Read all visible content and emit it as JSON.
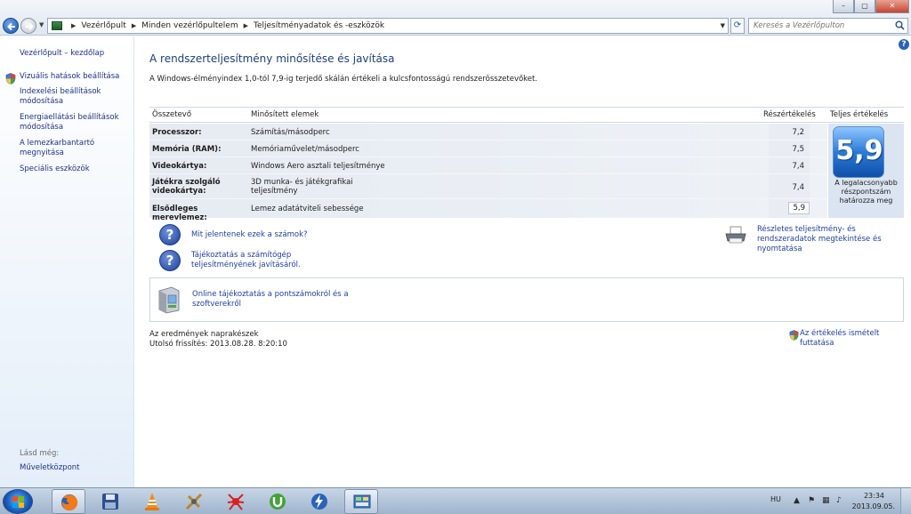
{
  "window": {
    "breadcrumb": [
      "Vezérlőpult",
      "Minden vezérlőpultelem",
      "Teljesítményadatok és -eszközök"
    ],
    "search_placeholder": "Keresés a Vezérlőpulton",
    "controls": {
      "minimize": "–",
      "maximize": "▢",
      "close": "✕"
    }
  },
  "sidebar": {
    "home": "Vezérlőpult – kezdőlap",
    "items": [
      "Vizuális hatások beállítása",
      "Indexelési beállítások módosítása",
      "Energiaellátási beállítások módosítása",
      "A lemezkarbantartó megnyitása",
      "Speciális eszközök"
    ],
    "see_also": "Lásd még:",
    "action_center": "Műveletközpont"
  },
  "main": {
    "title": "A rendszerteljesítmény minősítése és javítása",
    "subtitle": "A Windows-élményindex 1,0-tól 7,9-ig terjedő skálán értékeli a kulcsfontosságú rendszerösszetevőket.",
    "table": {
      "headers": [
        "Összetevő",
        "Minősített elemek",
        "Részértékelés",
        "Teljes értékelés"
      ],
      "rows": [
        {
          "component": "Processzor:",
          "rated": "Számítás/másodperc",
          "score": "7,2"
        },
        {
          "component": "Memória (RAM):",
          "rated": "Memóriaművelet/másodperc",
          "score": "7,5"
        },
        {
          "component": "Videokártya:",
          "rated": "Windows Aero asztali teljesítménye",
          "score": "7,4"
        },
        {
          "component": "Játékra szolgáló videokártya:",
          "rated": "3D munka- és játékgrafikai teljesítmény",
          "score": "7,4"
        },
        {
          "component": "Elsődleges merevlemez:",
          "rated": "Lemez adatátviteli sebessége",
          "score": "5,9"
        }
      ],
      "base_score": "5,9",
      "base_score_text": "A legalacsonyabb részpontszám határozza meg"
    },
    "links": {
      "what_mean": "Mit jelentenek ezek a számok?",
      "tips": "Tájékoztatás a számítógép teljesítményének javításáról.",
      "details": "Részletes teljesítmény- és rendszeradatok megtekintése és nyomtatása",
      "online": "Online tájékoztatás a pontszámokról és a szoftverekről",
      "rerun": "Az értékelés ismételt futtatása"
    },
    "status": {
      "current": "Az eredmények naprakészek",
      "last_update": "Utolsó frissítés: 2013.08.28. 8:20:10"
    }
  },
  "taskbar": {
    "apps": [
      "firefox",
      "floppy-save",
      "vlc",
      "tools",
      "spider",
      "utorrent",
      "flash",
      "control-panel"
    ],
    "language": "HU",
    "time": "23:34",
    "date": "2013.09.05."
  }
}
